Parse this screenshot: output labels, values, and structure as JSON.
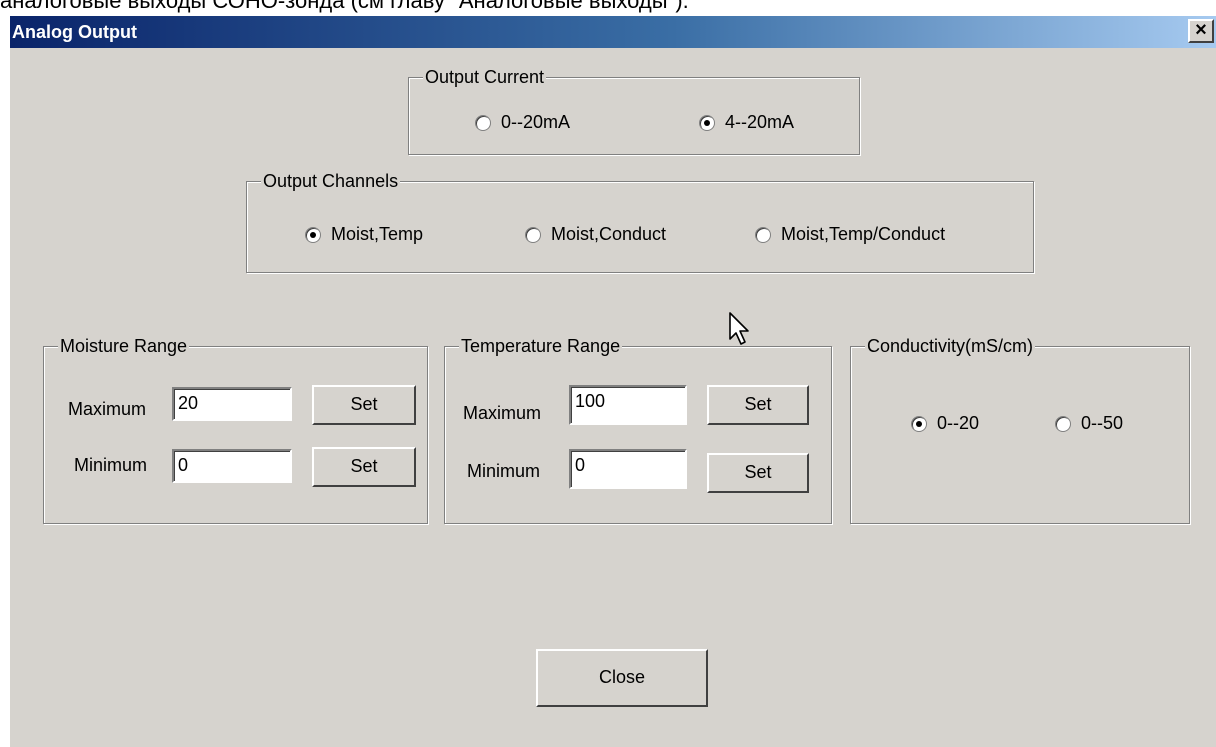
{
  "background_text": "аналоговые выходы СОНО-зонда (см главу \"Аналоговые выходы\").",
  "window": {
    "title": "Analog Output",
    "close_glyph": "✕"
  },
  "output_current": {
    "legend": "Output Current",
    "options": [
      {
        "label": "0--20mA",
        "checked": false
      },
      {
        "label": "4--20mA",
        "checked": true
      }
    ]
  },
  "output_channels": {
    "legend": "Output Channels",
    "options": [
      {
        "label": "Moist,Temp",
        "checked": true
      },
      {
        "label": "Moist,Conduct",
        "checked": false
      },
      {
        "label": "Moist,Temp/Conduct",
        "checked": false
      }
    ]
  },
  "moisture_range": {
    "legend": "Moisture Range",
    "max_label": "Maximum",
    "max_value": "20",
    "min_label": "Minimum",
    "min_value": "0",
    "set_label": "Set"
  },
  "temperature_range": {
    "legend": "Temperature Range",
    "max_label": "Maximum",
    "max_value": "100",
    "min_label": "Minimum",
    "min_value": "0",
    "set_label": "Set"
  },
  "conductivity": {
    "legend": "Conductivity(mS/cm)",
    "options": [
      {
        "label": "0--20",
        "checked": true
      },
      {
        "label": "0--50",
        "checked": false
      }
    ]
  },
  "close_button_label": "Close",
  "colors": {
    "face": "#d6d3ce",
    "title_start": "#0a246a",
    "title_end": "#a6caf0"
  }
}
